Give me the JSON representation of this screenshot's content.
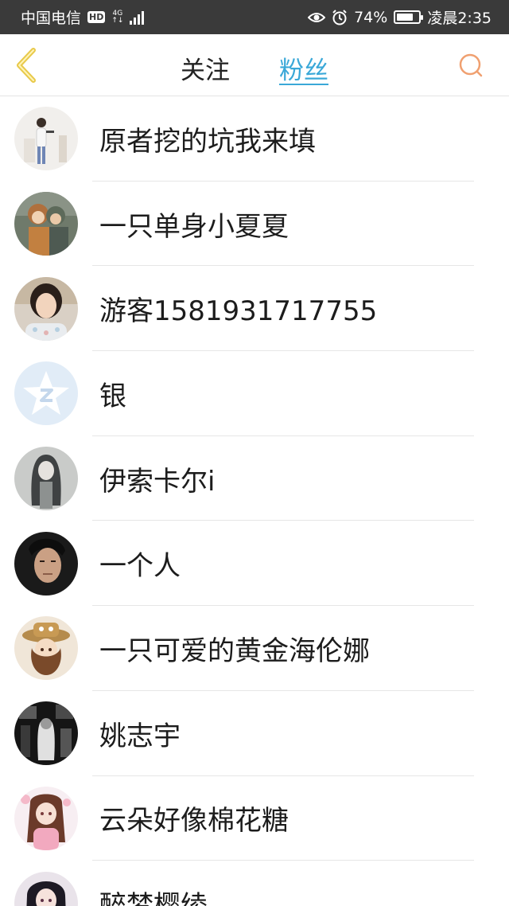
{
  "status_bar": {
    "carrier": "中国电信",
    "hd": "HD",
    "network": "4G",
    "battery_percent": "74%",
    "battery_level": 0.74,
    "time": "凌晨2:35"
  },
  "header": {
    "tabs": [
      {
        "label": "关注",
        "active": false
      },
      {
        "label": "粉丝",
        "active": true
      }
    ],
    "back_icon": "chevron-left-icon",
    "search_icon": "search-icon",
    "accent_color": "#3aa8d8",
    "back_color": "#e8c94a",
    "search_color": "#f0a070"
  },
  "followers": [
    {
      "name": "原者挖的坑我来填",
      "avatar": "photo-person-light"
    },
    {
      "name": "一只单身小夏夏",
      "avatar": "illustration-duo"
    },
    {
      "name": "游客1581931717755",
      "avatar": "photo-woman"
    },
    {
      "name": "银",
      "avatar": "default-qzone"
    },
    {
      "name": "伊索卡尔i",
      "avatar": "illustration-gray-girl"
    },
    {
      "name": "一个人",
      "avatar": "photo-man"
    },
    {
      "name": "一只可爱的黄金海伦娜",
      "avatar": "illustration-hat-girl"
    },
    {
      "name": "姚志宇",
      "avatar": "dark-scene"
    },
    {
      "name": "云朵好像棉花糖",
      "avatar": "illustration-pink-girl"
    },
    {
      "name": "醉梦樱绫",
      "avatar": "illustration-dark-hair-girl"
    }
  ]
}
